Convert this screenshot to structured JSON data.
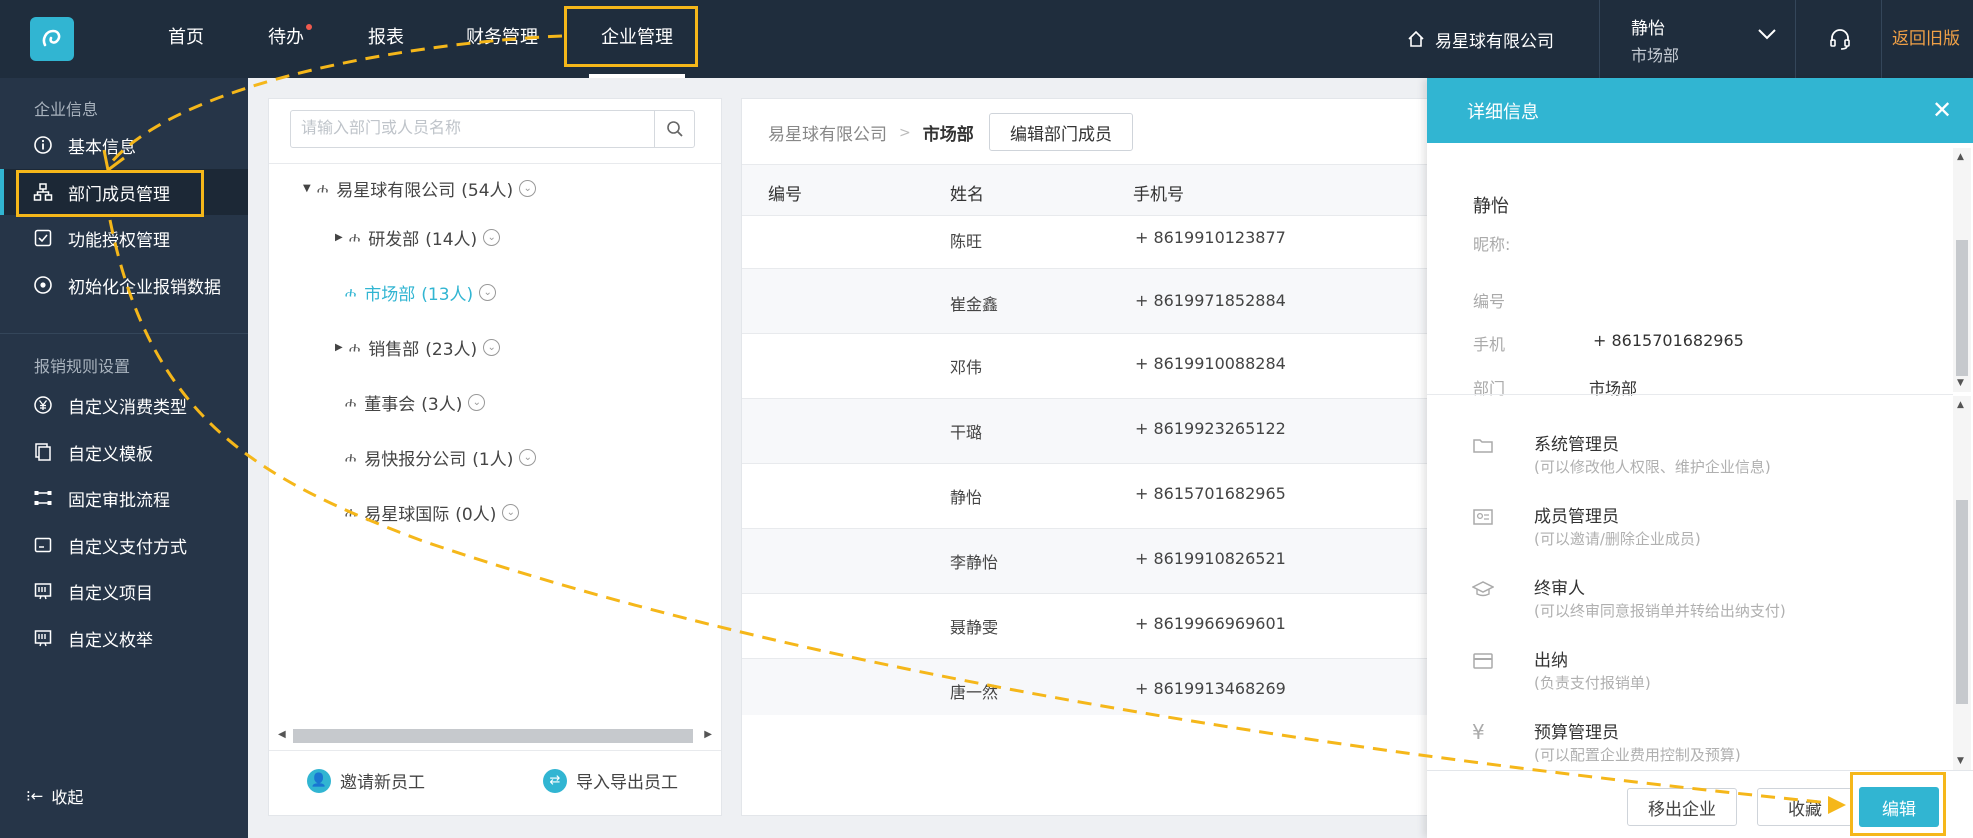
{
  "nav": {
    "items": [
      "首页",
      "待办",
      "报表",
      "财务管理",
      "企业管理"
    ],
    "active_index": 4
  },
  "header": {
    "company": "易星球有限公司",
    "user_name": "静怡",
    "user_dept": "市场部",
    "back_old": "返回旧版"
  },
  "sidebar": {
    "group1": "企业信息",
    "items1": [
      "基本信息",
      "部门成员管理",
      "功能授权管理",
      "初始化企业报销数据"
    ],
    "group2": "报销规则设置",
    "items2": [
      "自定义消费类型",
      "自定义模板",
      "固定审批流程",
      "自定义支付方式",
      "自定义项目",
      "自定义枚举"
    ],
    "collapse": "收起"
  },
  "tree": {
    "search_placeholder": "请输入部门或人员名称",
    "nodes": [
      {
        "name": "易星球有限公司",
        "count": "(54人)"
      },
      {
        "name": "研发部",
        "count": "(14人)"
      },
      {
        "name": "市场部",
        "count": "(13人)"
      },
      {
        "name": "销售部",
        "count": "(23人)"
      },
      {
        "name": "董事会",
        "count": "(3人)"
      },
      {
        "name": "易快报分公司",
        "count": "(1人)"
      },
      {
        "name": "易星球国际",
        "count": "(0人)"
      }
    ],
    "invite": "邀请新员工",
    "import_export": "导入导出员工"
  },
  "members": {
    "breadcrumb_root": "易星球有限公司",
    "breadcrumb_current": "市场部",
    "edit_button": "编辑部门成员",
    "columns": [
      "编号",
      "姓名",
      "手机号"
    ],
    "rows": [
      {
        "name": "陈旺",
        "phone": "+ 8619910123877"
      },
      {
        "name": "崔金鑫",
        "phone": "+ 8619971852884"
      },
      {
        "name": "邓伟",
        "phone": "+ 8619910088284"
      },
      {
        "name": "干璐",
        "phone": "+ 8619923265122"
      },
      {
        "name": "静怡",
        "phone": "+ 8615701682965"
      },
      {
        "name": "李静怡",
        "phone": "+ 8619910826521"
      },
      {
        "name": "聂静雯",
        "phone": "+ 8619966969601"
      },
      {
        "name": "唐一然",
        "phone": "+ 8619913468269"
      }
    ]
  },
  "detail": {
    "title": "详细信息",
    "name": "静怡",
    "nickname_label": "昵称:",
    "id_label": "编号",
    "phone_label": "手机",
    "phone": "+ 8615701682965",
    "dept_label": "部门",
    "dept": "市场部",
    "roles": [
      {
        "title": "系统管理员",
        "desc": "(可以修改他人权限、维护企业信息)",
        "icon": "folder-icon"
      },
      {
        "title": "成员管理员",
        "desc": "(可以邀请/删除企业成员)",
        "icon": "id-card-icon"
      },
      {
        "title": "终审人",
        "desc": "(可以终审同意报销单并转给出纳支付)",
        "icon": "graduation-cap-icon"
      },
      {
        "title": "出纳",
        "desc": "(负责支付报销单)",
        "icon": "card-icon"
      },
      {
        "title": "预算管理员",
        "desc": "(可以配置企业费用控制及预算)",
        "icon": "yen-icon"
      }
    ],
    "btn_remove": "移出企业",
    "btn_collect": "收藏",
    "btn_edit": "编辑"
  },
  "colors": {
    "topbar": "#1f2d3d",
    "sidebar": "#263548",
    "accent": "#31b5d2",
    "highlight": "#f5b71a",
    "back_old": "#f0a046"
  }
}
